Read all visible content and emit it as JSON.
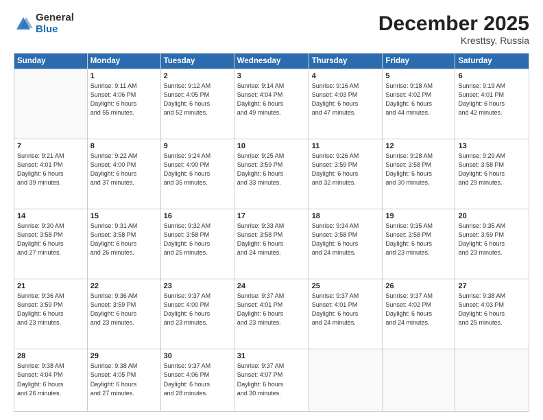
{
  "logo": {
    "general": "General",
    "blue": "Blue"
  },
  "title": {
    "month": "December 2025",
    "location": "Kresttsy, Russia"
  },
  "days_of_week": [
    "Sunday",
    "Monday",
    "Tuesday",
    "Wednesday",
    "Thursday",
    "Friday",
    "Saturday"
  ],
  "weeks": [
    [
      {
        "day": "",
        "info": ""
      },
      {
        "day": "1",
        "info": "Sunrise: 9:11 AM\nSunset: 4:06 PM\nDaylight: 6 hours\nand 55 minutes."
      },
      {
        "day": "2",
        "info": "Sunrise: 9:12 AM\nSunset: 4:05 PM\nDaylight: 6 hours\nand 52 minutes."
      },
      {
        "day": "3",
        "info": "Sunrise: 9:14 AM\nSunset: 4:04 PM\nDaylight: 6 hours\nand 49 minutes."
      },
      {
        "day": "4",
        "info": "Sunrise: 9:16 AM\nSunset: 4:03 PM\nDaylight: 6 hours\nand 47 minutes."
      },
      {
        "day": "5",
        "info": "Sunrise: 9:18 AM\nSunset: 4:02 PM\nDaylight: 6 hours\nand 44 minutes."
      },
      {
        "day": "6",
        "info": "Sunrise: 9:19 AM\nSunset: 4:01 PM\nDaylight: 6 hours\nand 42 minutes."
      }
    ],
    [
      {
        "day": "7",
        "info": "Sunrise: 9:21 AM\nSunset: 4:01 PM\nDaylight: 6 hours\nand 39 minutes."
      },
      {
        "day": "8",
        "info": "Sunrise: 9:22 AM\nSunset: 4:00 PM\nDaylight: 6 hours\nand 37 minutes."
      },
      {
        "day": "9",
        "info": "Sunrise: 9:24 AM\nSunset: 4:00 PM\nDaylight: 6 hours\nand 35 minutes."
      },
      {
        "day": "10",
        "info": "Sunrise: 9:25 AM\nSunset: 3:59 PM\nDaylight: 6 hours\nand 33 minutes."
      },
      {
        "day": "11",
        "info": "Sunrise: 9:26 AM\nSunset: 3:59 PM\nDaylight: 6 hours\nand 32 minutes."
      },
      {
        "day": "12",
        "info": "Sunrise: 9:28 AM\nSunset: 3:58 PM\nDaylight: 6 hours\nand 30 minutes."
      },
      {
        "day": "13",
        "info": "Sunrise: 9:29 AM\nSunset: 3:58 PM\nDaylight: 6 hours\nand 29 minutes."
      }
    ],
    [
      {
        "day": "14",
        "info": "Sunrise: 9:30 AM\nSunset: 3:58 PM\nDaylight: 6 hours\nand 27 minutes."
      },
      {
        "day": "15",
        "info": "Sunrise: 9:31 AM\nSunset: 3:58 PM\nDaylight: 6 hours\nand 26 minutes."
      },
      {
        "day": "16",
        "info": "Sunrise: 9:32 AM\nSunset: 3:58 PM\nDaylight: 6 hours\nand 25 minutes."
      },
      {
        "day": "17",
        "info": "Sunrise: 9:33 AM\nSunset: 3:58 PM\nDaylight: 6 hours\nand 24 minutes."
      },
      {
        "day": "18",
        "info": "Sunrise: 9:34 AM\nSunset: 3:58 PM\nDaylight: 6 hours\nand 24 minutes."
      },
      {
        "day": "19",
        "info": "Sunrise: 9:35 AM\nSunset: 3:58 PM\nDaylight: 6 hours\nand 23 minutes."
      },
      {
        "day": "20",
        "info": "Sunrise: 9:35 AM\nSunset: 3:59 PM\nDaylight: 6 hours\nand 23 minutes."
      }
    ],
    [
      {
        "day": "21",
        "info": "Sunrise: 9:36 AM\nSunset: 3:59 PM\nDaylight: 6 hours\nand 23 minutes."
      },
      {
        "day": "22",
        "info": "Sunrise: 9:36 AM\nSunset: 3:59 PM\nDaylight: 6 hours\nand 23 minutes."
      },
      {
        "day": "23",
        "info": "Sunrise: 9:37 AM\nSunset: 4:00 PM\nDaylight: 6 hours\nand 23 minutes."
      },
      {
        "day": "24",
        "info": "Sunrise: 9:37 AM\nSunset: 4:01 PM\nDaylight: 6 hours\nand 23 minutes."
      },
      {
        "day": "25",
        "info": "Sunrise: 9:37 AM\nSunset: 4:01 PM\nDaylight: 6 hours\nand 24 minutes."
      },
      {
        "day": "26",
        "info": "Sunrise: 9:37 AM\nSunset: 4:02 PM\nDaylight: 6 hours\nand 24 minutes."
      },
      {
        "day": "27",
        "info": "Sunrise: 9:38 AM\nSunset: 4:03 PM\nDaylight: 6 hours\nand 25 minutes."
      }
    ],
    [
      {
        "day": "28",
        "info": "Sunrise: 9:38 AM\nSunset: 4:04 PM\nDaylight: 6 hours\nand 26 minutes."
      },
      {
        "day": "29",
        "info": "Sunrise: 9:38 AM\nSunset: 4:05 PM\nDaylight: 6 hours\nand 27 minutes."
      },
      {
        "day": "30",
        "info": "Sunrise: 9:37 AM\nSunset: 4:06 PM\nDaylight: 6 hours\nand 28 minutes."
      },
      {
        "day": "31",
        "info": "Sunrise: 9:37 AM\nSunset: 4:07 PM\nDaylight: 6 hours\nand 30 minutes."
      },
      {
        "day": "",
        "info": ""
      },
      {
        "day": "",
        "info": ""
      },
      {
        "day": "",
        "info": ""
      }
    ]
  ]
}
